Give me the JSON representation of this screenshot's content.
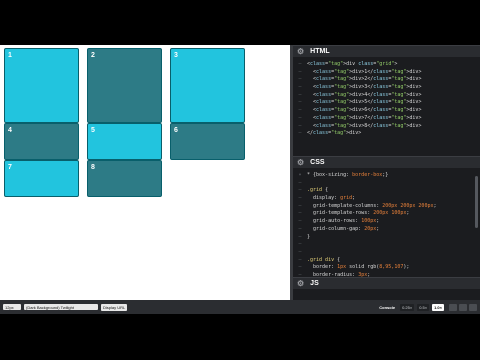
{
  "preview": {
    "cells": [
      {
        "label": "1",
        "shade": "light"
      },
      {
        "label": "2",
        "shade": "dark"
      },
      {
        "label": "3",
        "shade": "light"
      },
      {
        "label": "4",
        "shade": "dark"
      },
      {
        "label": "5",
        "shade": "light"
      },
      {
        "label": "6",
        "shade": "dark"
      },
      {
        "label": "7",
        "shade": "light"
      },
      {
        "label": "8",
        "shade": "dark"
      }
    ]
  },
  "html_panel": {
    "title": "HTML",
    "lines": [
      "<div class=\"grid\">",
      "  <div>1</div>",
      "  <div>2</div>",
      "  <div>3</div>",
      "  <div>4</div>",
      "  <div>5</div>",
      "  <div>6</div>",
      "  <div>7</div>",
      "  <div>8</div>",
      "</div>"
    ]
  },
  "css_panel": {
    "title": "CSS",
    "lines": [
      "* {box-sizing: border-box;}",
      "",
      ".grid {",
      "  display: grid;",
      "  grid-template-columns: 200px 200px 200px;",
      "  grid-template-rows: 200px 100px;",
      "  grid-auto-rows: 100px;",
      "  grid-column-gap: 20px;",
      "}",
      "",
      "",
      ".grid div {",
      "  border: 1px solid rgb(8,95,107);",
      "  border-radius: 3px;"
    ]
  },
  "js_panel": {
    "title": "JS"
  },
  "toolbar": {
    "font_size": "12px",
    "theme": "(Dark Background) Twilight",
    "display_label": "Display URL",
    "console": "Console",
    "zoom_levels": [
      "0.25×",
      "0.5×",
      "1.0×"
    ]
  },
  "colors": {
    "cell_light": "#22c4de",
    "cell_dark": "#2d7b86"
  }
}
